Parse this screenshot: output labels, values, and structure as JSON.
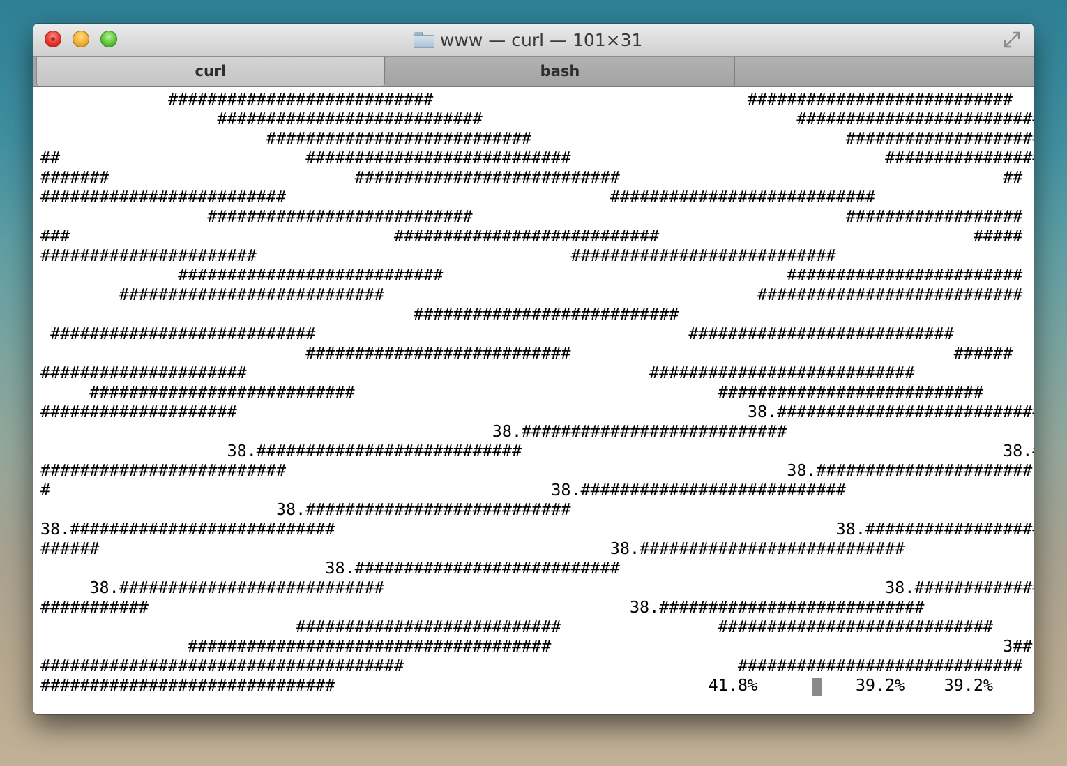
{
  "window": {
    "title": "www — curl — 101×31",
    "title_icon": "folder-icon",
    "traffic_lights": [
      "close",
      "minimize",
      "zoom"
    ],
    "fullscreen_icon": "fullscreen-arrows-icon"
  },
  "tabs": [
    {
      "label": "curl",
      "active": true
    },
    {
      "label": "bash",
      "active": false
    },
    {
      "label": "",
      "active": false
    }
  ],
  "terminal": {
    "background": "#ffffff",
    "foreground": "#000000",
    "cursor_color": "#8a8a8a",
    "lines": [
      "             ###########################                                ###########################",
      "                  ###########################                                ###########################",
      "                       ###########################                                ######################",
      "##                         ###########################                                ##################",
      "#######                         ###########################                                       ##",
      "#########################                                 ###########################",
      "                 ###########################                                      ##################",
      "###                                 ###########################                                #####",
      "######################                                ###########################",
      "              ###########################                                   ########################",
      "        ###########################                                      ###########################",
      "                                      ###########################",
      " ###########################                                      ###########################",
      "                           ###########################                                       ######",
      "#####################                                         ###########################",
      "     ###########################                                     ###########################       #######",
      "####################                                                    38.###########################",
      "                                              38.###########################",
      "                   38.###########################                                                 38.##",
      "#########################                                                   38.######################",
      "#                                                   38.###########################",
      "                        38.###########################",
      "38.###########################                                                   38.####################",
      "######                                                    38.###########################",
      "                             38.###########################",
      "     38.###########################                                                   38.################",
      "###########                                                 38.###########################",
      "                          ###########################                ############################",
      "               #####################################                                              3##",
      "#####################################                                  #############################",
      "##############################                                      41.8%          39.2%    39.2%"
    ]
  }
}
